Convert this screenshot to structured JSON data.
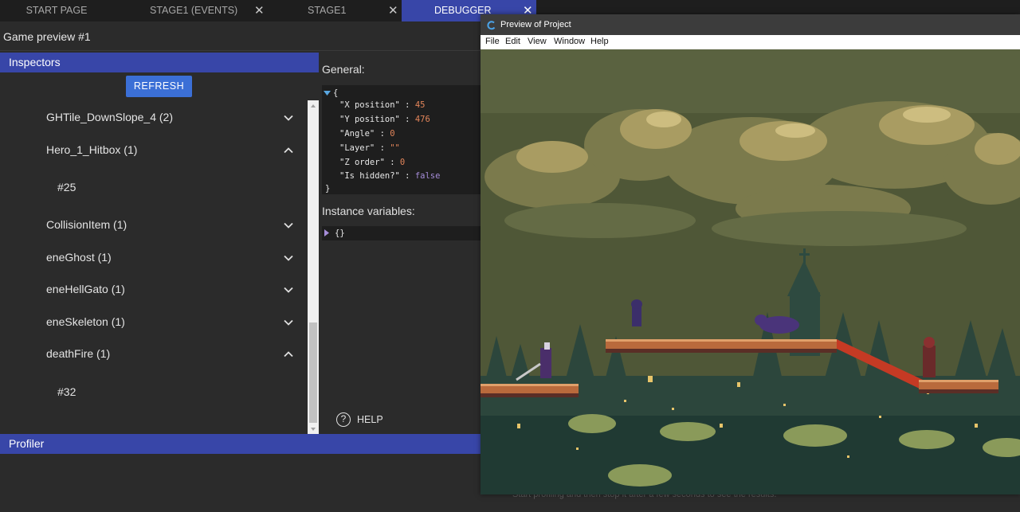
{
  "tabs": [
    {
      "label": "START PAGE",
      "closable": false,
      "active": false
    },
    {
      "label": "STAGE1 (EVENTS)",
      "closable": true,
      "active": false
    },
    {
      "label": "STAGE1",
      "closable": true,
      "active": false
    },
    {
      "label": "DEBUGGER",
      "closable": true,
      "active": true
    }
  ],
  "close_glyph": "✕",
  "subbar": {
    "title": "Game preview #1"
  },
  "inspectors": {
    "header": "Inspectors",
    "refresh_label": "REFRESH",
    "items": [
      {
        "label": "GHTile_DownSlope_4 (2)",
        "expanded": false
      },
      {
        "label": "Hero_1_Hitbox (1)",
        "expanded": true,
        "child": "#25"
      },
      {
        "label": "CollisionItem (1)",
        "expanded": false
      },
      {
        "label": "eneGhost (1)",
        "expanded": false
      },
      {
        "label": "eneHellGato (1)",
        "expanded": false
      },
      {
        "label": "eneSkeleton (1)",
        "expanded": false
      },
      {
        "label": "deathFire (1)",
        "expanded": true,
        "child": "#32"
      }
    ]
  },
  "general": {
    "label": "General:",
    "open_brace": "{",
    "close_brace": "}",
    "fields": [
      {
        "key": "\"X position\"",
        "sep": " : ",
        "value": "45",
        "kind": "num"
      },
      {
        "key": "\"Y position\"",
        "sep": " : ",
        "value": "476",
        "kind": "num"
      },
      {
        "key": "\"Angle\"",
        "sep": " : ",
        "value": "0",
        "kind": "num"
      },
      {
        "key": "\"Layer\"",
        "sep": " : ",
        "value": "\"\"",
        "kind": "str"
      },
      {
        "key": "\"Z order\"",
        "sep": " : ",
        "value": "0",
        "kind": "num"
      },
      {
        "key": "\"Is hidden?\"",
        "sep": " : ",
        "value": "false",
        "kind": "bool"
      }
    ]
  },
  "instance_variables": {
    "label": "Instance variables:",
    "value": "{}"
  },
  "help": {
    "label": "HELP",
    "glyph": "?"
  },
  "profiler": {
    "header": "Profiler",
    "hint": "Start profiling and then stop it after a few seconds to see the results."
  },
  "preview_window": {
    "title": "Preview of Project",
    "menu": [
      "File",
      "Edit",
      "View",
      "Window",
      "Help"
    ]
  },
  "colors": {
    "accent": "#3846a8",
    "button": "#3b6fd6",
    "number": "#e3855a",
    "boolean": "#a68dd9"
  }
}
